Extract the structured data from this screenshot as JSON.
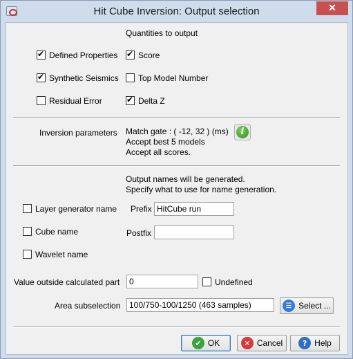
{
  "window": {
    "title": "Hit Cube Inversion: Output selection",
    "close_glyph": "✕"
  },
  "quantities": {
    "heading": "Quantities to output",
    "items": [
      {
        "label": "Defined Properties",
        "checked": true
      },
      {
        "label": "Score",
        "checked": true
      },
      {
        "label": "Synthetic Seismics",
        "checked": true
      },
      {
        "label": "Top Model Number",
        "checked": false
      },
      {
        "label": "Residual Error",
        "checked": false
      },
      {
        "label": "Delta Z",
        "checked": true
      }
    ]
  },
  "inversion": {
    "label": "Inversion parameters",
    "line1": "Match gate : ( -12, 32 ) (ms)",
    "line2": "Accept best 5 models",
    "line3": "Accept all scores.",
    "info_glyph": "i"
  },
  "names": {
    "line1": "Output names will be generated.",
    "line2": "Specify what to use for name generation.",
    "layer_generator": {
      "label": "Layer generator name",
      "checked": false
    },
    "cube_name": {
      "label": "Cube name",
      "checked": false
    },
    "wavelet_name": {
      "label": "Wavelet name",
      "checked": false
    },
    "prefix_label": "Prefix",
    "prefix_value": "HitCube run",
    "postfix_label": "Postfix",
    "postfix_value": ""
  },
  "outside": {
    "label": "Value outside calculated part",
    "value": "0",
    "undefined_label": "Undefined",
    "undefined_checked": false
  },
  "area": {
    "label": "Area subselection",
    "value": "100/750-100/1250 (463 samples)",
    "select_label": "Select ..."
  },
  "buttons": {
    "ok": "OK",
    "cancel": "Cancel",
    "help": "Help"
  }
}
